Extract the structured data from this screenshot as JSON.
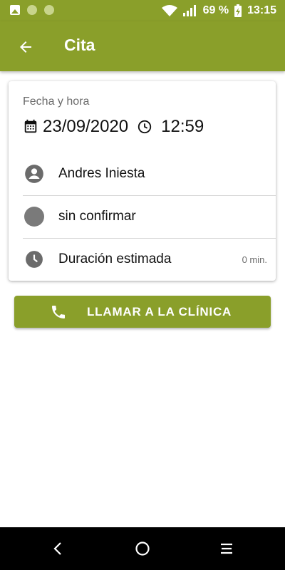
{
  "status_bar": {
    "battery": "69 %",
    "time": "13:15"
  },
  "app_bar": {
    "title": "Cita",
    "back_icon": "arrow-left-icon"
  },
  "appointment": {
    "date_label": "Fecha y hora",
    "date": "23/09/2020",
    "time": "12:59",
    "patient": "Andres Iniesta",
    "status": "sin confirmar",
    "duration_label": "Duración estimada",
    "duration_value": "0 min."
  },
  "call_button": {
    "label": "LLAMAR A LA CLÍNICA",
    "icon": "phone-icon"
  },
  "colors": {
    "primary": "#8a9f2a"
  }
}
